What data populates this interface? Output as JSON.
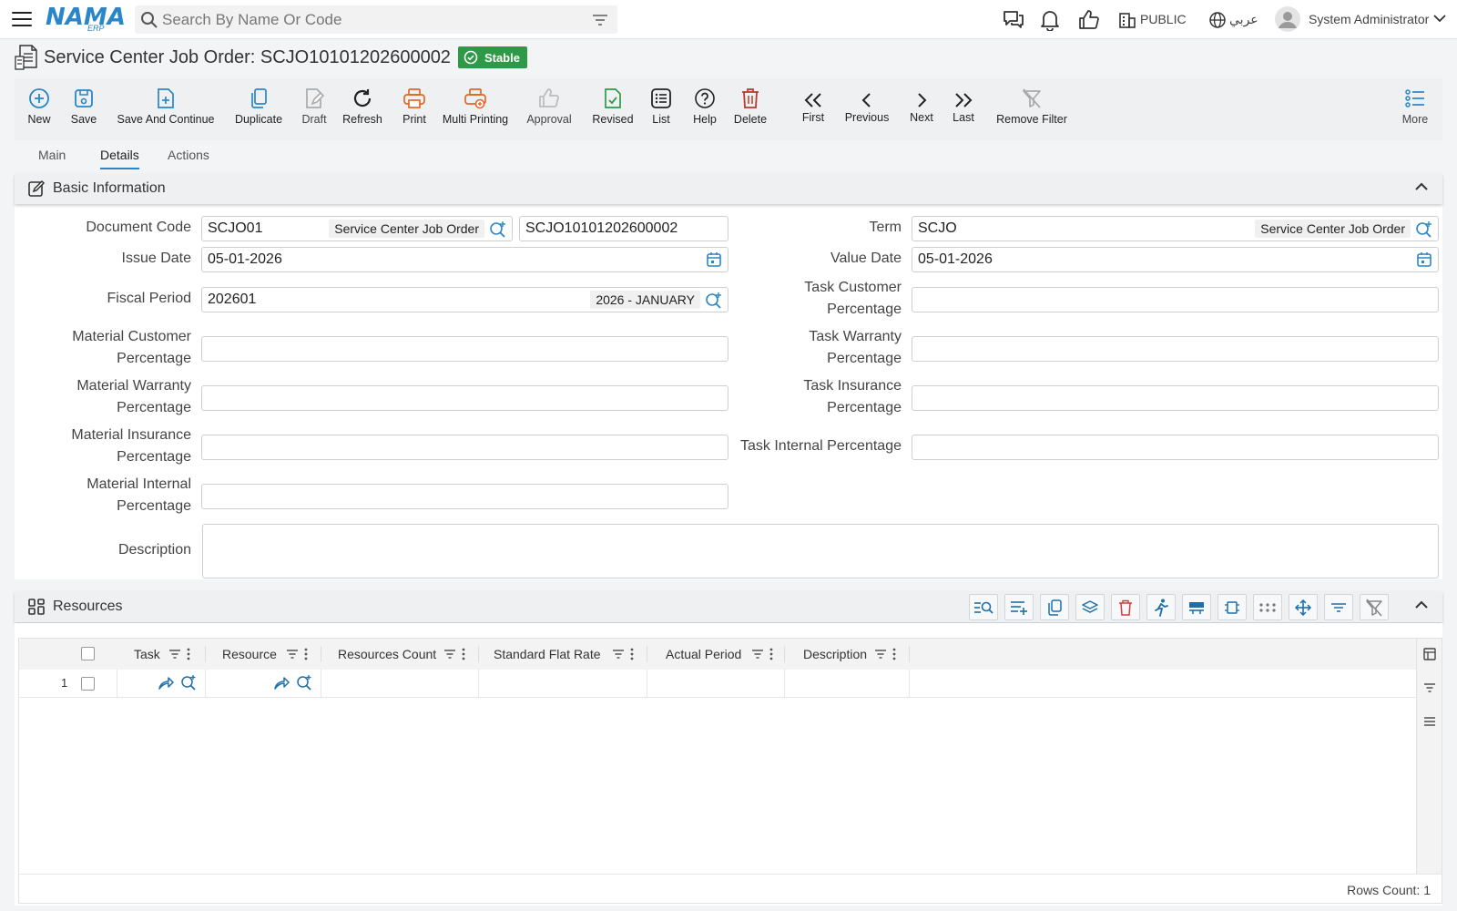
{
  "header": {
    "logo": "NAMA",
    "logo_sub": "ERP",
    "search_placeholder": "Search By Name Or Code",
    "branch": "PUBLIC",
    "language": "عربي",
    "user": "System Administrator"
  },
  "page": {
    "title": "Service Center Job Order: SCJO10101202600002",
    "status": "Stable"
  },
  "toolbar": {
    "new": "New",
    "save": "Save",
    "save_continue": "Save And Continue",
    "duplicate": "Duplicate",
    "draft": "Draft",
    "refresh": "Refresh",
    "print": "Print",
    "multi_printing": "Multi Printing",
    "approval": "Approval",
    "revised": "Revised",
    "list": "List",
    "help": "Help",
    "delete": "Delete",
    "first": "First",
    "previous": "Previous",
    "next": "Next",
    "last": "Last",
    "remove_filter": "Remove Filter",
    "more": "More"
  },
  "tabs": [
    "Main",
    "Details",
    "Actions"
  ],
  "basic_info": {
    "title": "Basic Information",
    "document_code_label": "Document Code",
    "document_code": "SCJO01",
    "document_code_tag": "Service Center Job Order",
    "document_number": "SCJO10101202600002",
    "term_label": "Term",
    "term": "SCJO",
    "term_tag": "Service Center Job Order",
    "issue_date_label": "Issue Date",
    "issue_date": "05-01-2026",
    "value_date_label": "Value Date",
    "value_date": "05-01-2026",
    "fiscal_period_label": "Fiscal Period",
    "fiscal_period": "202601",
    "fiscal_period_tag": "2026 - JANUARY",
    "task_customer_label_1": "Task Customer",
    "task_customer_label_2": "Percentage",
    "material_customer_label_1": "Material Customer",
    "material_customer_label_2": "Percentage",
    "task_warranty_label_1": "Task Warranty",
    "task_warranty_label_2": "Percentage",
    "material_warranty_label_1": "Material Warranty",
    "material_warranty_label_2": "Percentage",
    "task_insurance_label_1": "Task Insurance",
    "task_insurance_label_2": "Percentage",
    "material_insurance_label_1": "Material Insurance",
    "material_insurance_label_2": "Percentage",
    "task_internal_label": "Task Internal Percentage",
    "material_internal_label_1": "Material Internal",
    "material_internal_label_2": "Percentage",
    "description_label": "Description"
  },
  "resources": {
    "title": "Resources",
    "columns": [
      "Task",
      "Resource",
      "Resources Count",
      "Standard Flat Rate",
      "Actual Period",
      "Description"
    ],
    "row_number": "1",
    "rows_count": "Rows Count: 1"
  }
}
